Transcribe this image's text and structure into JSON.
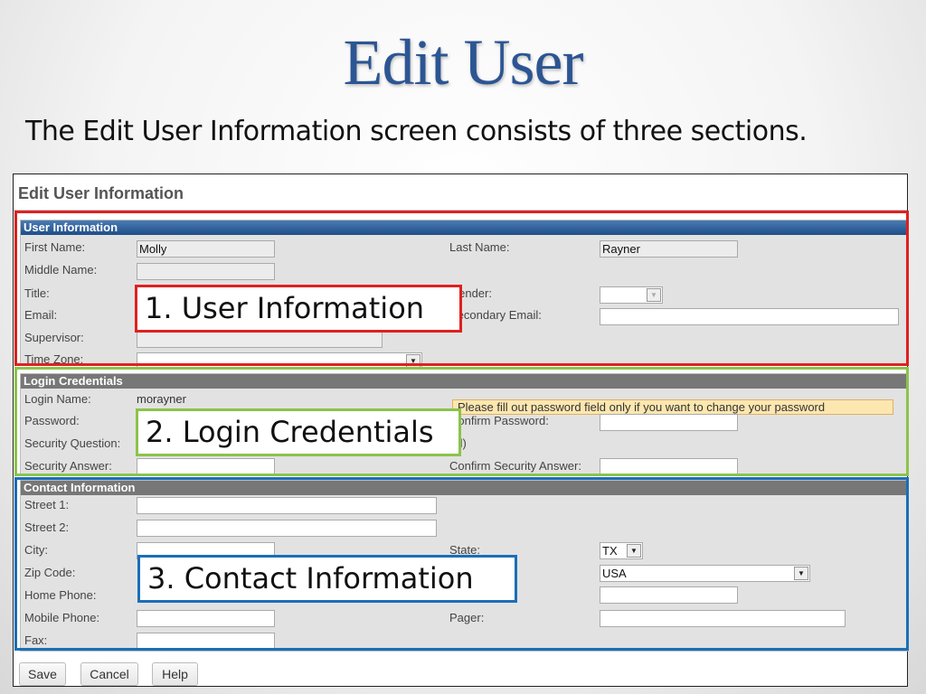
{
  "slide": {
    "title": "Edit User",
    "subtitle": "The Edit User Information screen consists of three sections."
  },
  "screenshot": {
    "header": "Edit User Information",
    "user_info": {
      "section_title": "User Information",
      "first_name_label": "First Name:",
      "first_name_value": "Molly",
      "last_name_label": "Last Name:",
      "last_name_value": "Rayner",
      "middle_name_label": "Middle Name:",
      "middle_name_value": "",
      "title_label": "Title:",
      "gender_label": "Gender:",
      "gender_value": "",
      "email_label": "Email:",
      "secondary_email_label": "Secondary Email:",
      "secondary_email_value": "",
      "supervisor_label": "Supervisor:",
      "time_zone_label": "Time Zone:",
      "time_zone_value": ""
    },
    "login": {
      "section_title": "Login Credentials",
      "login_name_label": "Login Name:",
      "login_name_value": "morayner",
      "notice": "Please fill out password field only if you want to change your password",
      "password_label": "Password:",
      "confirm_password_label": "Confirm Password:",
      "security_question_label": "Security Question:",
      "security_question_suffix": "ed)",
      "security_answer_label": "Security Answer:",
      "confirm_security_answer_label": "Confirm Security Answer:"
    },
    "contact": {
      "section_title": "Contact Information",
      "street1_label": "Street 1:",
      "street2_label": "Street 2:",
      "city_label": "City:",
      "state_label": "State:",
      "state_value": "TX",
      "zip_label": "Zip Code:",
      "country_value": "USA",
      "home_phone_label": "Home Phone:",
      "mobile_phone_label": "Mobile Phone:",
      "pager_label": "Pager:",
      "fax_label": "Fax:"
    },
    "buttons": {
      "save": "Save",
      "cancel": "Cancel",
      "help": "Help"
    }
  },
  "callouts": {
    "one": "1. User Information",
    "two": "2. Login Credentials",
    "three": "3. Contact Information"
  },
  "colors": {
    "title": "#2c5593",
    "callout_user": "#e02020",
    "callout_login": "#8cc34a",
    "callout_contact": "#1a6fb8"
  }
}
